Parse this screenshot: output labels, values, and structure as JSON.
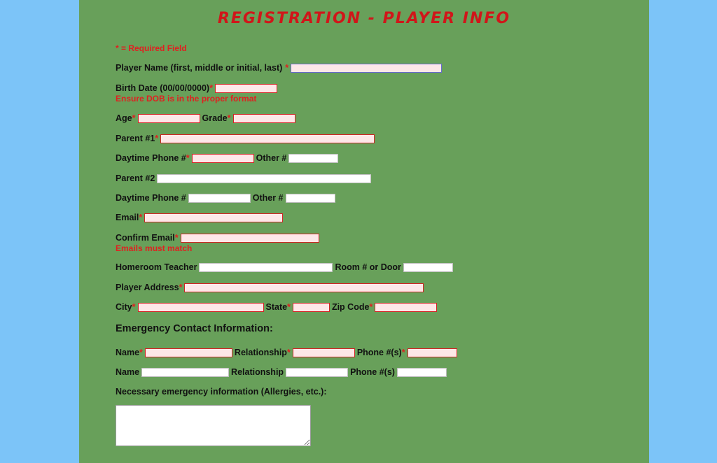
{
  "title": "REGISTRATION - PLAYER INFO",
  "required_note": "* = Required Field",
  "required_star": "*",
  "fields": {
    "player_name": "Player Name (first, middle or initial, last)",
    "birth_date": "Birth Date (00/00/0000)",
    "birth_date_error": "Ensure DOB is in the proper format",
    "age": "Age",
    "grade": "Grade",
    "parent1": "Parent #1",
    "daytime_phone1": "Daytime Phone #",
    "other1": "Other #",
    "parent2": "Parent #2",
    "daytime_phone2": "Daytime Phone #",
    "other2": "Other #",
    "email": "Email",
    "confirm_email": "Confirm Email",
    "email_error": "Emails must match",
    "homeroom_teacher": "Homeroom Teacher",
    "room": "Room # or Door",
    "player_address": "Player Address",
    "city": "City",
    "state": "State",
    "zip": "Zip Code"
  },
  "emergency": {
    "heading": "Emergency Contact Information:",
    "name": "Name",
    "relationship": "Relationship",
    "phone": "Phone #(s)",
    "necessary_info": "Necessary emergency information (Allergies, etc.):"
  },
  "colors": {
    "page_bg": "#7cc4f8",
    "panel_bg": "#68a05a",
    "title": "#d0161a",
    "required": "#e02020"
  }
}
